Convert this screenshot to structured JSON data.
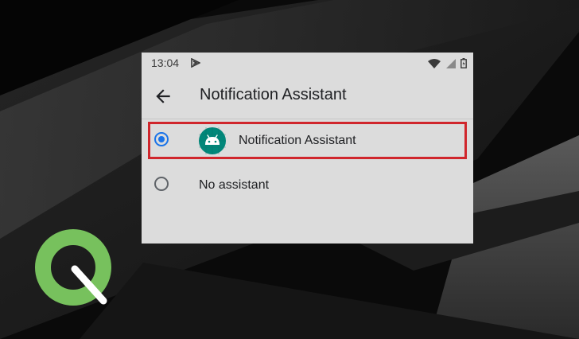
{
  "status_bar": {
    "time": "13:04",
    "app_icon": "play-store-icon",
    "icons": [
      "wifi-icon",
      "cell-signal-icon",
      "battery-icon"
    ]
  },
  "app_bar": {
    "back_icon": "arrow-back-icon",
    "title": "Notification Assistant"
  },
  "options": [
    {
      "label": "Notification Assistant",
      "selected": true,
      "icon": "android-icon"
    },
    {
      "label": "No assistant",
      "selected": false
    }
  ],
  "colors": {
    "accent": "#1a73e8",
    "highlight_border": "#d0262c",
    "app_icon_bg": "#01877a",
    "logo_green": "#77c15d"
  }
}
